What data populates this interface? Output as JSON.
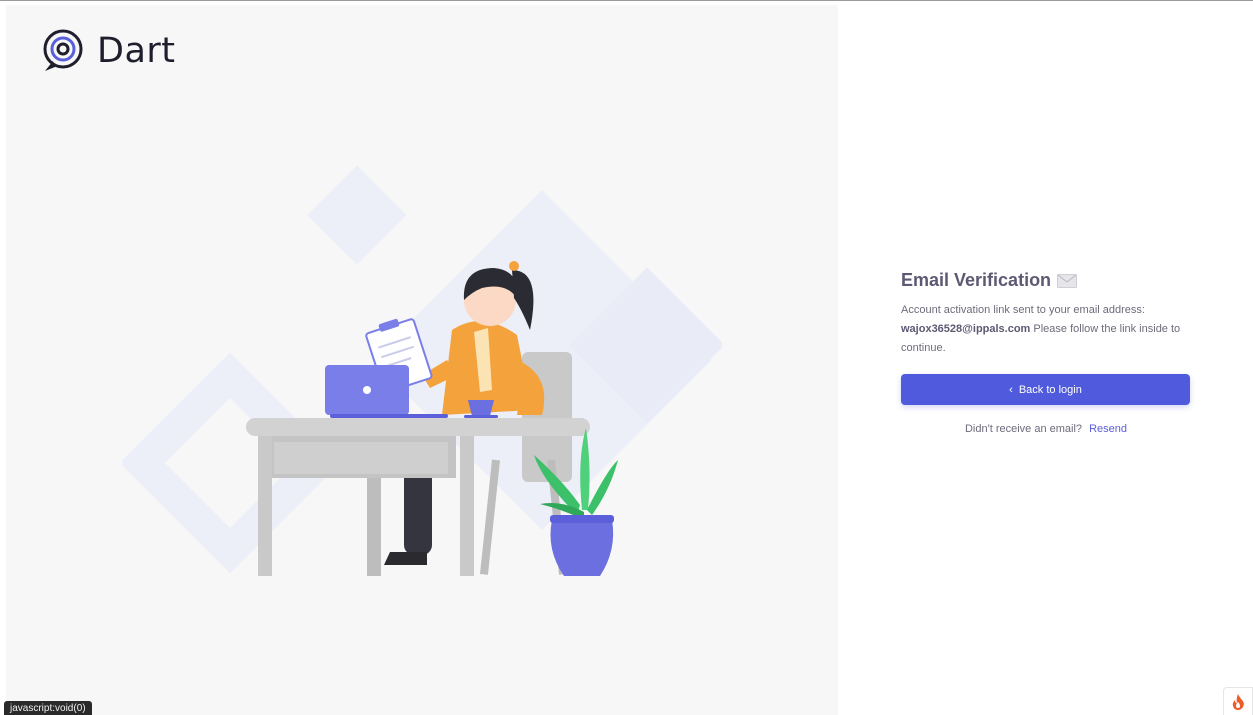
{
  "brand": {
    "name": "Dart"
  },
  "verification": {
    "title": "Email Verification",
    "message_prefix": "Account activation link sent to your email address:",
    "email": "wajox36528@ippals.com",
    "message_suffix": "Please follow the link inside to continue.",
    "back_button_label": "Back to login",
    "resend_prompt": "Didn't receive an email?",
    "resend_link": "Resend"
  },
  "status_bar": {
    "text": "javascript:void(0)"
  },
  "icons": {
    "logo": "target-logo-icon",
    "envelope": "envelope-icon",
    "chevron": "chevron-left-icon",
    "flame": "flame-icon"
  },
  "colors": {
    "primary": "#4f5bdc",
    "link": "#5b5fd9",
    "title": "#5e5873",
    "body_text": "#6e6b7b",
    "left_bg": "#f7f7f7"
  }
}
